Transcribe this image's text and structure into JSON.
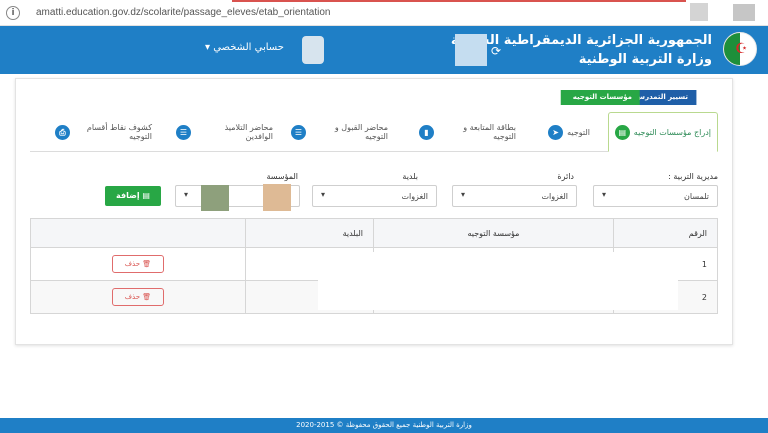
{
  "browser": {
    "url": "amatti.education.gov.dz/scolarite/passage_eleves/etab_orientation",
    "info_icon": "i"
  },
  "header": {
    "title_line1": "الجمهورية الجزائرية الديمقراطية الشعبية",
    "title_line2": "وزارة التربية الوطنية",
    "account_label": "حسابي الشخصي",
    "caret": "▾",
    "refresh_icon": "⟳",
    "flag_mark": "☪",
    "colors": {
      "bar": "#1f7fc6"
    }
  },
  "breadcrumb": {
    "items": [
      "تسيير التمدرس",
      "مؤسسات التوجيه"
    ]
  },
  "tabs": [
    {
      "label": "إدراج مؤسسات التوجيه",
      "icon": "▤",
      "active": true
    },
    {
      "label": "التوجيه",
      "icon": "➤",
      "active": false
    },
    {
      "label": "بطاقة المتابعة و التوجيه",
      "icon": "▮",
      "active": false
    },
    {
      "label": "محاضر القبول و التوجيه",
      "icon": "☰",
      "active": false
    },
    {
      "label": "محاضر التلاميذ الوافدين",
      "icon": "☰",
      "active": false
    },
    {
      "label": "كشوف نقاط أقسام التوجيه",
      "icon": "⎙",
      "active": false
    }
  ],
  "filters": {
    "directorate": {
      "label": "مديرية التربية :",
      "value": "تلمسان"
    },
    "daira": {
      "label": "دائرة",
      "value": "الغزوات"
    },
    "commune": {
      "label": "بلدية",
      "value": "الغزوات"
    },
    "institution": {
      "label": "المؤسسة",
      "value": ""
    },
    "add_button": "إضافة",
    "add_icon": "▤"
  },
  "table": {
    "headers": {
      "number": "الرقم",
      "institution": "مؤسسة التوجيه",
      "commune": "البلدية"
    },
    "rows": [
      {
        "number": "1",
        "institution": "",
        "commune": "",
        "delete": "حذف",
        "delete_icon": "🗑"
      },
      {
        "number": "2",
        "institution": "",
        "commune": "",
        "delete": "حذف",
        "delete_icon": "🗑"
      }
    ]
  },
  "footer": {
    "text": "وزارة التربية الوطنية جميع الحقوق محفوظة © 2015-2020"
  }
}
